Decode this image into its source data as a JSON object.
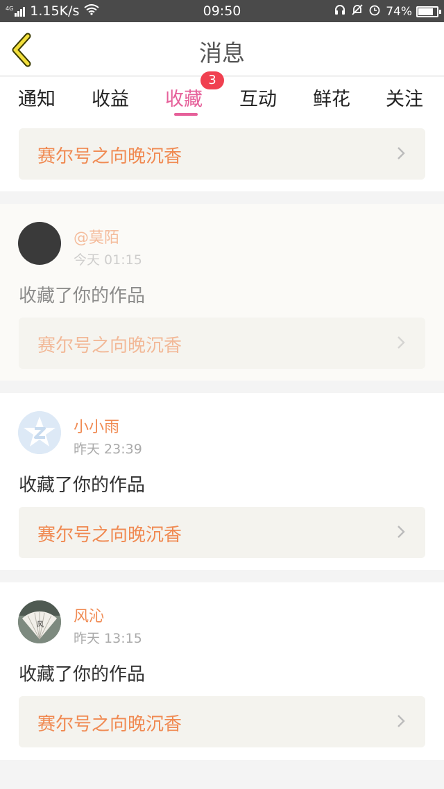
{
  "status_bar": {
    "network": "1.15K/s",
    "network_tag": "4G",
    "time": "09:50",
    "battery": "74%",
    "battery_level": 0.74
  },
  "header": {
    "title": "消息"
  },
  "tabs": [
    {
      "label": "通知"
    },
    {
      "label": "收益"
    },
    {
      "label": "收藏",
      "active": true,
      "badge": "3"
    },
    {
      "label": "互动"
    },
    {
      "label": "鲜花"
    },
    {
      "label": "关注"
    }
  ],
  "top_work": {
    "title": "赛尔号之向晚沉香"
  },
  "messages": [
    {
      "username": "@莫陌",
      "time": "今天 01:15",
      "action": "收藏了你的作品",
      "work": "赛尔号之向晚沉香",
      "avatar": "dark-circle"
    },
    {
      "username": "小小雨",
      "time": "昨天 23:39",
      "action": "收藏了你的作品",
      "work": "赛尔号之向晚沉香",
      "avatar": "default-z-logo"
    },
    {
      "username": "风沁",
      "time": "昨天 13:15",
      "action": "收藏了你的作品",
      "work": "赛尔号之向晚沉香",
      "avatar": "fan-photo"
    }
  ],
  "colors": {
    "accent": "#e6609a",
    "orange": "#f08a52",
    "badge": "#f04050"
  }
}
